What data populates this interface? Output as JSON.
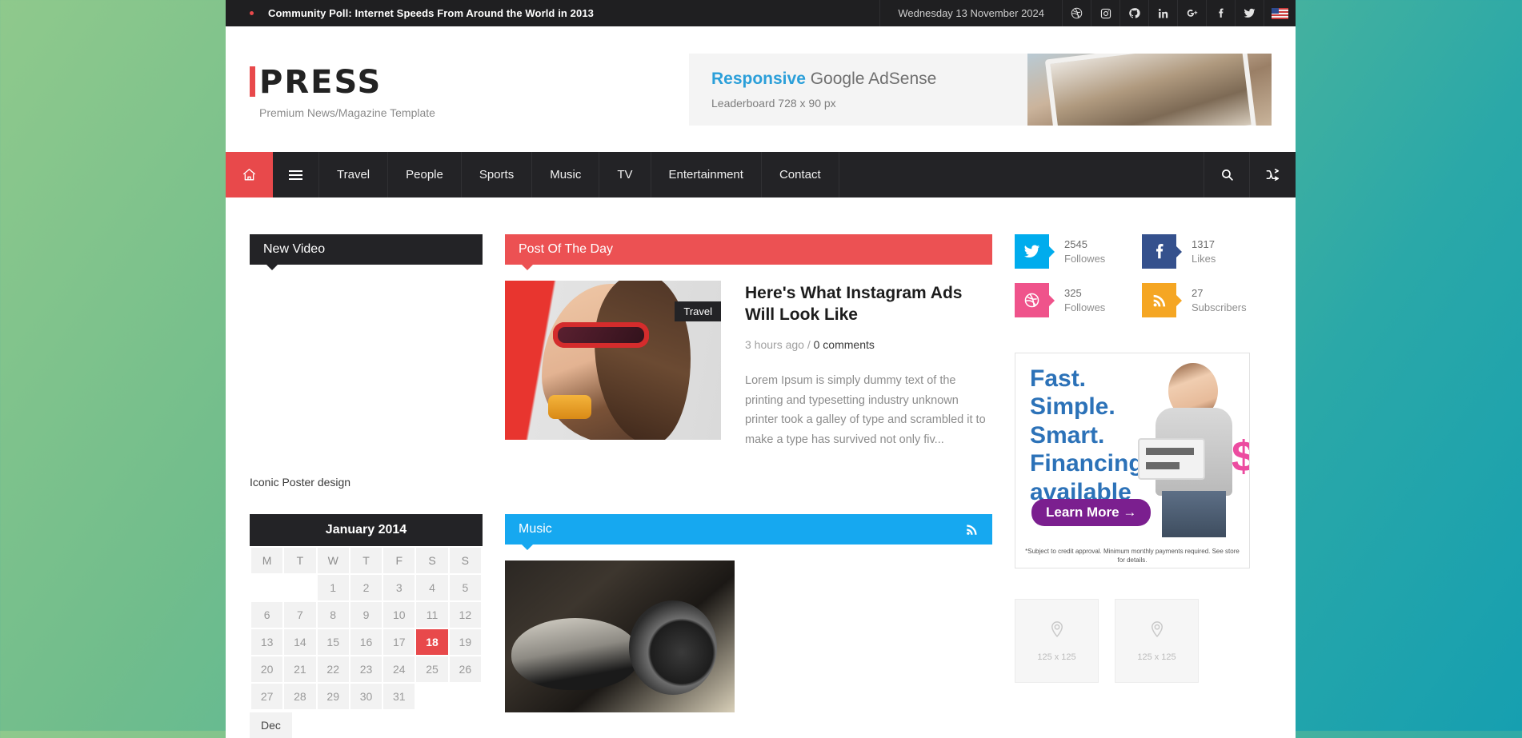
{
  "topbar": {
    "ticker_text": "Community Poll: Internet Speeds From Around the World in 2013",
    "date": "Wednesday 13 November 2024",
    "social": [
      {
        "name": "dribbble-icon",
        "label": "Dribbble"
      },
      {
        "name": "instagram-icon",
        "label": "Instagram"
      },
      {
        "name": "github-icon",
        "label": "GitHub"
      },
      {
        "name": "linkedin-icon",
        "label": "LinkedIn"
      },
      {
        "name": "google-plus-icon",
        "label": "Google Plus"
      },
      {
        "name": "facebook-icon",
        "label": "Facebook"
      },
      {
        "name": "twitter-icon",
        "label": "Twitter"
      }
    ],
    "flag": "us-flag-icon"
  },
  "header": {
    "logo_accent": "i",
    "logo_text": "Press",
    "tagline": "Premium News/Magazine Template",
    "leaderboard": {
      "headline_accent": "Responsive",
      "headline_rest": " Google AdSense",
      "subline": "Leaderboard 728 x 90 px"
    }
  },
  "nav": {
    "home_icon": "home-icon",
    "menu_icon": "hamburger-icon",
    "items": [
      {
        "label": "Travel"
      },
      {
        "label": "People"
      },
      {
        "label": "Sports"
      },
      {
        "label": "Music"
      },
      {
        "label": "TV"
      },
      {
        "label": "Entertainment"
      },
      {
        "label": "Contact"
      }
    ],
    "search_icon": "search-icon",
    "random_icon": "shuffle-icon"
  },
  "left_column": {
    "video_widget": {
      "title": "New Video",
      "caption": "Iconic Poster design"
    },
    "calendar": {
      "month_label": "January 2014",
      "weekdays": [
        "M",
        "T",
        "W",
        "T",
        "F",
        "S",
        "S"
      ],
      "weeks": [
        [
          "",
          "",
          "1",
          "2",
          "3",
          "4",
          "5"
        ],
        [
          "6",
          "7",
          "8",
          "9",
          "10",
          "11",
          "12"
        ],
        [
          "13",
          "14",
          "15",
          "16",
          "17",
          "18",
          "19"
        ],
        [
          "20",
          "21",
          "22",
          "23",
          "24",
          "25",
          "26"
        ],
        [
          "27",
          "28",
          "29",
          "30",
          "31",
          "",
          ""
        ]
      ],
      "today": "18",
      "prev_label": "Dec"
    }
  },
  "main_column": {
    "post_of_the_day": {
      "section_title": "Post Of The Day",
      "category_badge": "Travel",
      "title": "Here's What Instagram Ads Will Look Like",
      "time": "3 hours ago",
      "separator": "/",
      "comments": "0 comments",
      "excerpt": "Lorem Ipsum is simply dummy text of the printing and typesetting industry unknown printer took a galley of type and scrambled it to make a type has survived not only fiv..."
    },
    "music": {
      "section_title": "Music",
      "rss_icon": "rss-icon"
    }
  },
  "right_column": {
    "social_widgets": [
      {
        "icon": "twitter-icon",
        "count": "2545",
        "label": "Followes",
        "color": "#00aced"
      },
      {
        "icon": "facebook-icon",
        "count": "1317",
        "label": "Likes",
        "color": "#35518d"
      },
      {
        "icon": "dribbble-icon",
        "count": "325",
        "label": "Followes",
        "color": "#ef538b"
      },
      {
        "icon": "rss-icon",
        "count": "27",
        "label": "Subscribers",
        "color": "#f5a623"
      }
    ],
    "ad": {
      "line1": "Fast.",
      "line2": "Simple.",
      "line3": "Smart.",
      "line4": "Financing",
      "line5": "available",
      "cta": "Learn More →",
      "disclaimer": "*Subject to credit approval. Minimum monthly payments required. See store for details."
    },
    "placeholders": [
      {
        "label": "125 x 125",
        "icon": "map-pin-icon"
      },
      {
        "label": "125 x 125",
        "icon": "map-pin-icon"
      }
    ]
  }
}
